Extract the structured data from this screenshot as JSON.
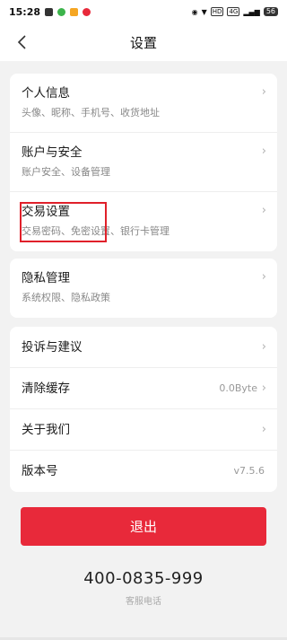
{
  "status_bar": {
    "time": "15:28",
    "network_badge": "4G",
    "battery": "56"
  },
  "nav": {
    "title": "设置"
  },
  "card1": {
    "items": [
      {
        "title": "个人信息",
        "subtitle": "头像、昵称、手机号、收货地址"
      },
      {
        "title": "账户与安全",
        "subtitle": "账户安全、设备管理"
      },
      {
        "title": "交易设置",
        "subtitle": "交易密码、免密设置、银行卡管理"
      }
    ]
  },
  "card2": {
    "items": [
      {
        "title": "隐私管理",
        "subtitle": "系统权限、隐私政策"
      }
    ]
  },
  "card3": {
    "items": [
      {
        "title": "投诉与建议"
      },
      {
        "title": "清除缓存",
        "value": "0.0Byte"
      },
      {
        "title": "关于我们"
      },
      {
        "title": "版本号",
        "value": "v7.5.6"
      }
    ]
  },
  "logout": {
    "label": "退出"
  },
  "contact": {
    "phone": "400-0835-999",
    "label": "客服电话"
  },
  "colors": {
    "accent": "#e8293a",
    "highlight": "#e0202a",
    "background": "#f2f2f2"
  },
  "icons": {
    "back": "chevron-left-icon",
    "row_arrow": "chevron-right-icon"
  }
}
